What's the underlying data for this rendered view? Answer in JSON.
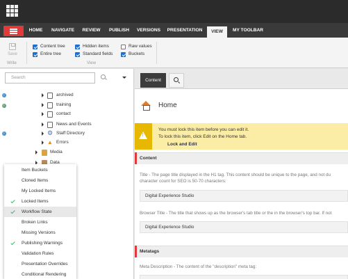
{
  "ribbon": {
    "tabs": [
      "HOME",
      "NAVIGATE",
      "REVIEW",
      "PUBLISH",
      "VERSIONS",
      "PRESENTATION",
      "VIEW",
      "MY TOOLBAR"
    ],
    "active_tab": "VIEW",
    "write_group": {
      "save_label": "Save",
      "group_label": "Write"
    },
    "view_group": {
      "group_label": "View",
      "checkboxes": [
        {
          "label": "Content tree",
          "checked": true
        },
        {
          "label": "Entire tree",
          "checked": true
        },
        {
          "label": "Hidden items",
          "checked": true
        },
        {
          "label": "Standard fields",
          "checked": true
        },
        {
          "label": "Raw values",
          "checked": false
        },
        {
          "label": "Buckets",
          "checked": true
        }
      ]
    }
  },
  "tree": {
    "search_placeholder": "Search",
    "items": [
      {
        "label": "archived",
        "icon": "document-icon"
      },
      {
        "label": "training",
        "icon": "document-icon"
      },
      {
        "label": "contact",
        "icon": "document-icon"
      },
      {
        "label": "News and Events",
        "icon": "document-icon"
      },
      {
        "label": "Staff Directory",
        "icon": "gear-icon"
      },
      {
        "label": "Errors",
        "icon": "warning-icon"
      },
      {
        "label": "Media",
        "icon": "media-icon"
      },
      {
        "label": "Data",
        "icon": "data-icon"
      }
    ]
  },
  "context_menu": {
    "items": [
      {
        "label": "Item Buckets",
        "checked": false,
        "highlighted": false
      },
      {
        "label": "Cloned Items",
        "checked": false,
        "highlighted": false
      },
      {
        "label": "My Locked Items",
        "checked": false,
        "highlighted": false
      },
      {
        "label": "Locked Items",
        "checked": true,
        "highlighted": false
      },
      {
        "label": "Workflow State",
        "checked": true,
        "highlighted": true
      },
      {
        "label": "Broken Links",
        "checked": false,
        "highlighted": false
      },
      {
        "label": "Missing Versions",
        "checked": false,
        "highlighted": false
      },
      {
        "label": "Publishing Warnings",
        "checked": true,
        "highlighted": false
      },
      {
        "label": "Validation Rules",
        "checked": false,
        "highlighted": false
      },
      {
        "label": "Presentation Overrides",
        "checked": false,
        "highlighted": false
      },
      {
        "label": "Conditional Rendering",
        "checked": false,
        "highlighted": false
      }
    ]
  },
  "editor": {
    "tab_label": "Content",
    "item_title": "Home",
    "warning": {
      "line1": "You must lock this item before you can edit it.",
      "line2": "To lock this item, click Edit on the Home tab.",
      "action": "Lock and Edit"
    },
    "sections": [
      {
        "title": "Content",
        "fields": [
          {
            "label": "Title - The page title displayed in the H1 tag. This content should be unique to the page, and not du",
            "label_cont": "character count for SEO is 50-70 characters:",
            "value": "Digital Experience Studio"
          },
          {
            "label": "Browser Title - The title that shows up as the browser's tab title or the in the browser's top bar. If not",
            "value": "Digital Experience Studio"
          }
        ]
      },
      {
        "title": "Metatags",
        "fields": [
          {
            "label": "Meta Description - The content of the \"description\" meta tag:"
          }
        ]
      }
    ]
  },
  "colors": {
    "accent_red": "#e03a3a",
    "topbar": "#2b2b2b",
    "warning_bg": "#fbeda5",
    "warning_strip": "#e6b800",
    "check_blue": "#1f6fd1",
    "check_green": "#3fae73"
  }
}
